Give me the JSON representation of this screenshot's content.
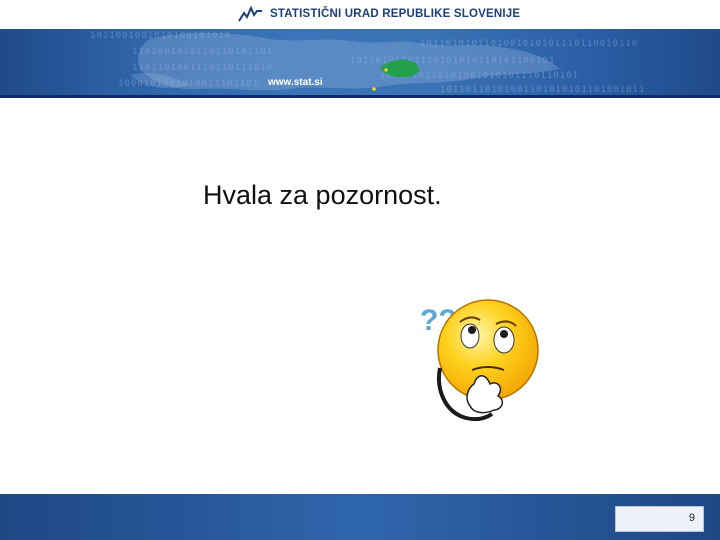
{
  "header": {
    "organization": "STATISTIČNI URAD REPUBLIKE SLOVENIJE",
    "url": "www.stat.si",
    "binary_rows": [
      "1011001001010100101010",
      "1101001010110110101101",
      "1101101001110110111010",
      "1000101001010011101101",
      "1011010101101001010101110110010110",
      "10110101001110101010110101100101",
      "1001010110101001010101110110101",
      "10110110101001101010101101001011"
    ]
  },
  "slide": {
    "title": "Hvala za pozornost.",
    "question_marks": "??"
  },
  "footer": {
    "page_number": "9"
  },
  "colors": {
    "header_blue": "#2e63a8",
    "footer_blue": "#2f66ac",
    "slovenia_green": "#22a04b",
    "smiley_yellow": "#ffd21f",
    "question_blue": "#5aa9d6"
  }
}
